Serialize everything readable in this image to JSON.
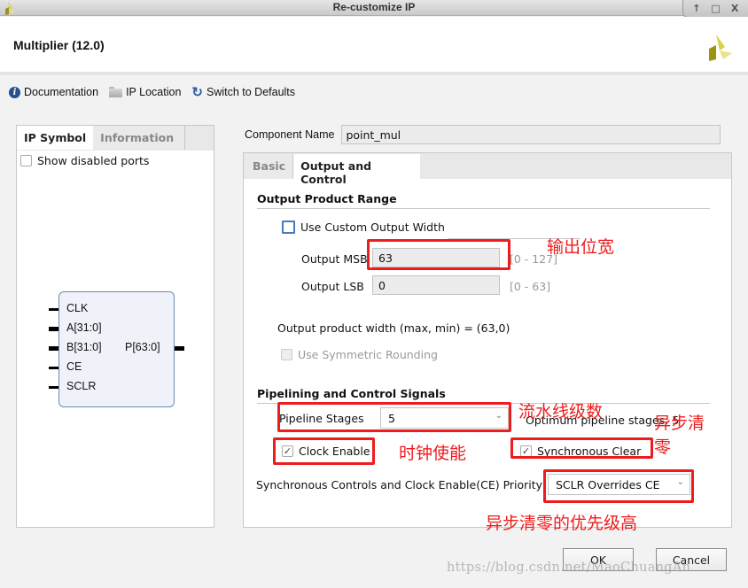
{
  "window": {
    "title": "Re-customize IP",
    "controls": {
      "up": "↑",
      "maximize": "□",
      "close": "X"
    }
  },
  "header": {
    "title": "Multiplier (12.0)",
    "logo_icon": "xilinx-logo-icon"
  },
  "toolbar": {
    "documentation": "Documentation",
    "ip_location": "IP Location",
    "switch_defaults": "Switch to Defaults"
  },
  "left_panel": {
    "tabs": [
      "IP Symbol",
      "Information"
    ],
    "active_tab": "IP Symbol",
    "show_disabled_ports": {
      "label": "Show disabled ports",
      "checked": false
    },
    "symbol": {
      "inputs": [
        "CLK",
        "A[31:0]",
        "B[31:0]",
        "CE",
        "SCLR"
      ],
      "outputs": [
        "P[63:0]"
      ]
    }
  },
  "component": {
    "label": "Component Name",
    "value": "point_mul"
  },
  "right_panel": {
    "tabs": [
      "Basic",
      "Output and Control"
    ],
    "active_tab": "Output and Control",
    "output_product_range": {
      "title": "Output Product Range",
      "use_custom_width": {
        "label": "Use Custom Output Width",
        "checked": false
      },
      "msb": {
        "label": "Output MSB",
        "value": "63",
        "range": "[0 - 127]"
      },
      "lsb": {
        "label": "Output LSB",
        "value": "0",
        "range": "[0 - 63]"
      },
      "product_width": "Output product width (max, min) = (63,0)",
      "symmetric_rounding": {
        "label": "Use Symmetric Rounding",
        "checked": false,
        "disabled": true
      }
    },
    "pipelining": {
      "title": "Pipelining and Control Signals",
      "stages_label": "Pipeline Stages",
      "stages_value": "5",
      "optimum_text": "Optimum pipeline stages: 5",
      "clock_enable": {
        "label": "Clock Enable",
        "checked": true
      },
      "sync_clear": {
        "label": "Synchronous Clear",
        "checked": true
      },
      "priority_label": "Synchronous Controls and Clock Enable(CE) Priority",
      "priority_value": "SCLR Overrides CE"
    }
  },
  "buttons": {
    "ok": "OK",
    "cancel": "Cancel"
  },
  "annotations": {
    "output_width": "输出位宽",
    "pipeline": "流水线级数",
    "clock_enable": "时钟使能",
    "sync_clear_line1": "异步清",
    "sync_clear_line2": "零",
    "priority": "异步清零的优先级高",
    "color": "#ee1c1c"
  },
  "watermark": "https://blog.csdn.net/MaoChuangAn"
}
